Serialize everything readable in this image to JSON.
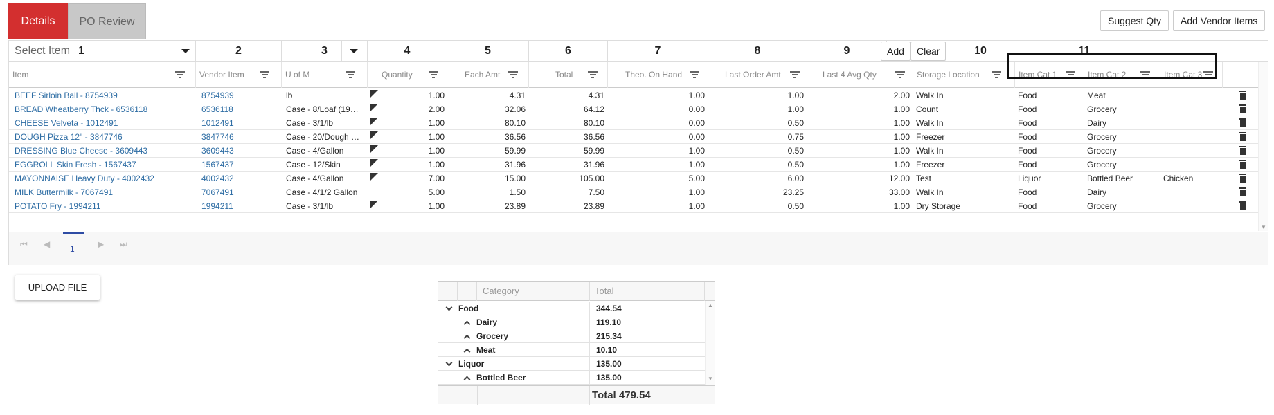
{
  "tabs": {
    "details": "Details",
    "po_review": "PO Review"
  },
  "toolbar": {
    "suggest_qty": "Suggest Qty",
    "add_vendor_items": "Add Vendor Items"
  },
  "select_row": {
    "placeholder": "Select Item",
    "add": "Add",
    "clear": "Clear",
    "markers": [
      "1",
      "2",
      "3",
      "4",
      "5",
      "6",
      "7",
      "8",
      "9",
      "10",
      "11"
    ]
  },
  "columns": [
    "Item",
    "Vendor Item",
    "U of M",
    "Quantity",
    "Each Amt",
    "Total",
    "Theo. On Hand",
    "Last Order Amt",
    "Last 4 Avg Qty",
    "Storage Location",
    "Item Cat 1",
    "Item Cat 2",
    "Item Cat 3"
  ],
  "rows": [
    {
      "item": "BEEF Sirloin Ball - 8754939",
      "vendor": "8754939",
      "uom": "lb",
      "flag": true,
      "qty": "1.00",
      "each": "4.31",
      "total": "4.31",
      "onhand": "1.00",
      "lastorder": "1.00",
      "avg": "2.00",
      "storage": "Walk In",
      "cat1": "Food",
      "cat2": "Meat",
      "cat3": ""
    },
    {
      "item": "BREAD Wheatberry Thck - 6536118",
      "vendor": "6536118",
      "uom": "Case - 8/Loaf (19…",
      "flag": true,
      "qty": "2.00",
      "each": "32.06",
      "total": "64.12",
      "onhand": "0.00",
      "lastorder": "1.00",
      "avg": "1.00",
      "storage": "Count",
      "cat1": "Food",
      "cat2": "Grocery",
      "cat3": ""
    },
    {
      "item": "CHEESE Velveta - 1012491",
      "vendor": "1012491",
      "uom": "Case - 3/1/lb",
      "flag": true,
      "qty": "1.00",
      "each": "80.10",
      "total": "80.10",
      "onhand": "0.00",
      "lastorder": "0.50",
      "avg": "1.00",
      "storage": "Walk In",
      "cat1": "Food",
      "cat2": "Dairy",
      "cat3": ""
    },
    {
      "item": "DOUGH Pizza 12\" - 3847746",
      "vendor": "3847746",
      "uom": "Case - 20/Dough …",
      "flag": true,
      "qty": "1.00",
      "each": "36.56",
      "total": "36.56",
      "onhand": "0.00",
      "lastorder": "0.75",
      "avg": "1.00",
      "storage": "Freezer",
      "cat1": "Food",
      "cat2": "Grocery",
      "cat3": ""
    },
    {
      "item": "DRESSING Blue Cheese - 3609443",
      "vendor": "3609443",
      "uom": "Case - 4/Gallon",
      "flag": true,
      "qty": "1.00",
      "each": "59.99",
      "total": "59.99",
      "onhand": "1.00",
      "lastorder": "0.50",
      "avg": "1.00",
      "storage": "Walk In",
      "cat1": "Food",
      "cat2": "Grocery",
      "cat3": ""
    },
    {
      "item": "EGGROLL Skin Fresh - 1567437",
      "vendor": "1567437",
      "uom": "Case - 12/Skin",
      "flag": true,
      "qty": "1.00",
      "each": "31.96",
      "total": "31.96",
      "onhand": "1.00",
      "lastorder": "0.50",
      "avg": "1.00",
      "storage": "Freezer",
      "cat1": "Food",
      "cat2": "Grocery",
      "cat3": ""
    },
    {
      "item": "MAYONNAISE Heavy Duty - 4002432",
      "vendor": "4002432",
      "uom": "Case - 4/Gallon",
      "flag": true,
      "qty": "7.00",
      "each": "15.00",
      "total": "105.00",
      "onhand": "5.00",
      "lastorder": "6.00",
      "avg": "12.00",
      "storage": "Test",
      "cat1": "Liquor",
      "cat2": "Bottled Beer",
      "cat3": "Chicken"
    },
    {
      "item": "MILK Buttermilk - 7067491",
      "vendor": "7067491",
      "uom": "Case - 4/1/2 Gallon",
      "flag": false,
      "qty": "5.00",
      "each": "1.50",
      "total": "7.50",
      "onhand": "1.00",
      "lastorder": "23.25",
      "avg": "33.00",
      "storage": "Walk In",
      "cat1": "Food",
      "cat2": "Dairy",
      "cat3": ""
    },
    {
      "item": "POTATO Fry - 1994211",
      "vendor": "1994211",
      "uom": "Case - 3/1/lb",
      "flag": true,
      "qty": "1.00",
      "each": "23.89",
      "total": "23.89",
      "onhand": "1.00",
      "lastorder": "0.50",
      "avg": "1.00",
      "storage": "Dry Storage",
      "cat1": "Food",
      "cat2": "Grocery",
      "cat3": ""
    }
  ],
  "pager": {
    "first": "⏮",
    "prev": "◀",
    "page": "1",
    "next": "▶",
    "last": "⏭"
  },
  "upload": {
    "label": "UPLOAD FILE"
  },
  "pivot": {
    "headers": {
      "category": "Category",
      "total": "Total"
    },
    "rows": [
      {
        "level": 0,
        "label": "Food",
        "value": "344.54",
        "expanded": true
      },
      {
        "level": 1,
        "label": "Dairy",
        "value": "119.10",
        "expanded": false
      },
      {
        "level": 1,
        "label": "Grocery",
        "value": "215.34",
        "expanded": false
      },
      {
        "level": 1,
        "label": "Meat",
        "value": "10.10",
        "expanded": false
      },
      {
        "level": 0,
        "label": "Liquor",
        "value": "135.00",
        "expanded": true
      },
      {
        "level": 1,
        "label": "Bottled Beer",
        "value": "135.00",
        "expanded": false
      }
    ],
    "footer": "Total 479.54"
  }
}
